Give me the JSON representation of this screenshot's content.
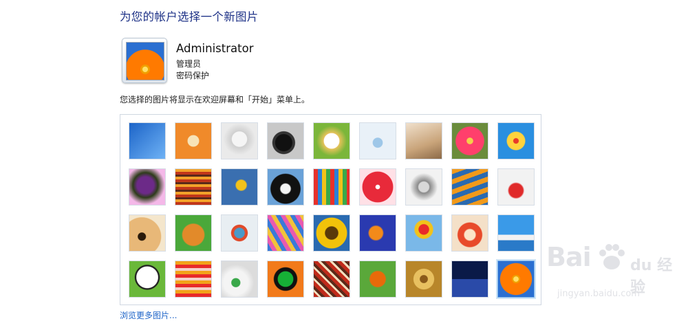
{
  "page": {
    "title": "为您的帐户选择一个新图片",
    "instruction": "您选择的图片将显示在欢迎屏幕和「开始」菜单上。",
    "browse_link": "浏览更多图片..."
  },
  "account": {
    "name": "Administrator",
    "role": "管理员",
    "password_status": "密码保护"
  },
  "pictures": [
    {
      "name": "roller-coaster",
      "bg": "linear-gradient(135deg,#1c64c8,#6fb2f5)"
    },
    {
      "name": "starfish",
      "bg": "radial-gradient(circle at 50% 50%,#f7e3b8 0 22%,#f08a2a 24%)"
    },
    {
      "name": "robot-toy",
      "bg": "radial-gradient(circle at 50% 45%,#f5f5f5 0 28%,#cfcfcf 30%,#eaeaea 60%)"
    },
    {
      "name": "record-player",
      "bg": "radial-gradient(circle at 45% 55%,#111 0 30%,#333 32% 40%,#c8c8c8 42%)"
    },
    {
      "name": "lucky-cat",
      "bg": "radial-gradient(circle at 50% 50%,#ffffff 0 30%,#e6c25a 32%,#7bb63a 60%)"
    },
    {
      "name": "gyroscope",
      "bg": "radial-gradient(circle at 50% 55%,#9ec7e8 0 18%,#e9f1f8 20%)"
    },
    {
      "name": "kitten",
      "bg": "linear-gradient(160deg,#f0e0cc,#c9a47a 60%,#8c6a48)"
    },
    {
      "name": "flower-pink",
      "bg": "radial-gradient(circle,#f4d04a 0 12%,#ff3f6c 14% 55%,#6a8c3c 58%)"
    },
    {
      "name": "ferris-wheel",
      "bg": "radial-gradient(circle at 50% 50%,#e83a2a 0 10%,#ffd33c 12% 35%,#2a8fe0 38%)"
    },
    {
      "name": "ball-striped",
      "bg": "radial-gradient(circle at 45% 45%,#6c2a88 0 30%,#2e3c1a 45%,#f4b8e8 70%)"
    },
    {
      "name": "fabric-stripes",
      "bg": "repeating-linear-gradient(0deg,#c0361a 0 4px,#f2a22a 4px 8px,#5a2a1a 8px 11px)"
    },
    {
      "name": "leaf",
      "bg": "radial-gradient(circle at 55% 45%,#f2c21a 0 18%,#3a6fb0 22%)"
    },
    {
      "name": "dog-border-collie",
      "bg": "radial-gradient(circle at 50% 55%,#f4f4f4 0 18%,#111 22% 55%,#6aa2d8 58%)"
    },
    {
      "name": "crayons",
      "bg": "repeating-linear-gradient(90deg,#e8312a 0 6px,#2a7fd8 6px 12px,#f2c21a 12px 18px,#3aa84a 18px 24px)"
    },
    {
      "name": "sparkle-star",
      "bg": "radial-gradient(circle,#ffffff 0 8%,#e82a3a 10% 60%,#ffe0e6 62%)"
    },
    {
      "name": "jacks",
      "bg": "radial-gradient(circle at 50% 50%,#d8d8d8 0 20%,#8a8a8a 24%,#f2f2f2 55%)"
    },
    {
      "name": "stairs",
      "bg": "repeating-linear-gradient(160deg,#f29a1a 0 7px,#2a6ab0 7px 14px)"
    },
    {
      "name": "paper-crane",
      "bg": "radial-gradient(circle at 50% 60%,#e02a2a 0 25%,#f2f2f2 30%)"
    },
    {
      "name": "guitar",
      "bg": "radial-gradient(circle at 35% 60%,#2a1a0a 0 12%,#e8b878 14% 60%,#f4e6cc 62%)"
    },
    {
      "name": "pomeranian",
      "bg": "radial-gradient(circle at 50% 55%,#e28a2a 0 40%,#4aa83a 44%)"
    },
    {
      "name": "tin-robot",
      "bg": "radial-gradient(circle at 50% 50%,#4a9ac8 0 20%,#e04a2a 22% 32%,#e8eef2 34%)"
    },
    {
      "name": "silk-fabric",
      "bg": "repeating-linear-gradient(60deg,#3a7ad8 0 6px,#e85ab0 6px 12px,#f2c23a 12px 18px)"
    },
    {
      "name": "sunflower",
      "bg": "radial-gradient(circle,#5a3a0a 0 25%,#f2c20a 28% 60%,#2a6ab0 62%)"
    },
    {
      "name": "clownfish",
      "bg": "radial-gradient(circle at 45% 50%,#f28a1a 0 25%,#2a3ab0 30%)"
    },
    {
      "name": "hot-air-balloon",
      "bg": "radial-gradient(circle at 50% 40%,#e82a2a 0 18%,#f2c21a 20% 32%,#7ab8e8 35%)"
    },
    {
      "name": "daruma-doll",
      "bg": "radial-gradient(circle at 50% 55%,#fbe6c8 0 20%,#e84a2a 24% 45%,#f4e0c8 48%)"
    },
    {
      "name": "sailboat",
      "bg": "linear-gradient(180deg,#3a9ae8 0 55%,#f2f2f2 55% 70%,#2a7ac8 70%)"
    },
    {
      "name": "soccer-ball",
      "bg": "radial-gradient(circle at 50% 45%,#ffffff 0 40%,#222 42% 46%,#6ab83a 48%)"
    },
    {
      "name": "cloth-stripes",
      "bg": "repeating-linear-gradient(0deg,#e82a2a 0 5px,#f2a21a 5px 10px,#f4d0c8 10px 14px)"
    },
    {
      "name": "marbles",
      "bg": "radial-gradient(circle at 40% 60%,#3aa84a 0 14%,#f4f4f4 16% 40%,#dcdcdc 60%)"
    },
    {
      "name": "window-frame",
      "bg": "radial-gradient(circle,#16b036 0 30%,#111 32% 45%,#f27a1a 48%)"
    },
    {
      "name": "woven-pattern",
      "bg": "repeating-linear-gradient(45deg,#c02a1a 0 5px,#f2e0c0 5px 8px,#5a2a1a 8px 12px)"
    },
    {
      "name": "butterfly",
      "bg": "radial-gradient(circle at 50% 50%,#e86a0a 0 30%,#5aa83a 34%)"
    },
    {
      "name": "golden-spiral",
      "bg": "radial-gradient(circle,#8a5a1a 0 15%,#e8c060 17% 40%,#b8862a 42%)"
    },
    {
      "name": "lighthouse",
      "bg": "linear-gradient(180deg,#0a1a48 0 50%,#2a4aa8 50%)"
    },
    {
      "name": "orange-flower",
      "bg": "radial-gradient(circle,#ffe066 0 10%,#f0a000 11% 16%,#ff7a00 17% 62%,#2a6fd1 64%)",
      "selected": true
    }
  ]
}
